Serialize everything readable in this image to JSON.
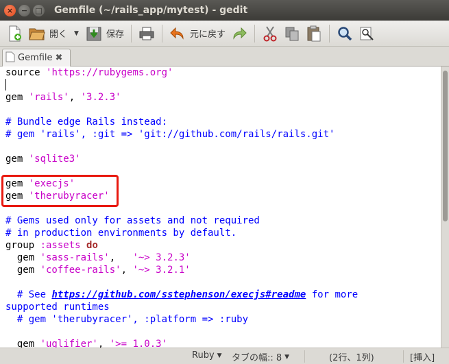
{
  "window": {
    "title": "Gemfile (~/rails_app/mytest) - gedit",
    "close_glyph": "×",
    "minimize_glyph": "−",
    "maximize_glyph": "□"
  },
  "toolbar": {
    "open_label": "開く",
    "save_label": "保存",
    "undo_label": "元に戻す",
    "dropdown_glyph": "▼"
  },
  "tab": {
    "label": "Gemfile",
    "close_glyph": "✖"
  },
  "editor": {
    "lines": [
      [
        {
          "t": "source ",
          "c": ""
        },
        {
          "t": "'https://rubygems.org'",
          "c": "str"
        }
      ],
      [],
      [
        {
          "t": "gem ",
          "c": ""
        },
        {
          "t": "'rails'",
          "c": "str"
        },
        {
          "t": ", ",
          "c": ""
        },
        {
          "t": "'3.2.3'",
          "c": "str"
        }
      ],
      [],
      [
        {
          "t": "# Bundle edge Rails instead:",
          "c": "cmt"
        }
      ],
      [
        {
          "t": "# gem 'rails', :git => 'git://github.com/rails/rails.git'",
          "c": "cmt"
        }
      ],
      [],
      [
        {
          "t": "gem ",
          "c": ""
        },
        {
          "t": "'sqlite3'",
          "c": "str"
        }
      ],
      [],
      [
        {
          "t": "gem ",
          "c": ""
        },
        {
          "t": "'execjs'",
          "c": "str"
        }
      ],
      [
        {
          "t": "gem ",
          "c": ""
        },
        {
          "t": "'therubyracer'",
          "c": "str"
        }
      ],
      [],
      [
        {
          "t": "# Gems used only for assets and not required",
          "c": "cmt"
        }
      ],
      [
        {
          "t": "# in production environments by default.",
          "c": "cmt"
        }
      ],
      [
        {
          "t": "group ",
          "c": ""
        },
        {
          "t": ":assets",
          "c": "sym"
        },
        {
          "t": " ",
          "c": ""
        },
        {
          "t": "do",
          "c": "kw"
        }
      ],
      [
        {
          "t": "  gem ",
          "c": ""
        },
        {
          "t": "'sass-rails'",
          "c": "str"
        },
        {
          "t": ",   ",
          "c": ""
        },
        {
          "t": "'~> 3.2.3'",
          "c": "str"
        }
      ],
      [
        {
          "t": "  gem ",
          "c": ""
        },
        {
          "t": "'coffee-rails'",
          "c": "str"
        },
        {
          "t": ", ",
          "c": ""
        },
        {
          "t": "'~> 3.2.1'",
          "c": "str"
        }
      ],
      [],
      [
        {
          "t": "  # See ",
          "c": "cmt"
        },
        {
          "t": "https://github.com/sstephenson/execjs#readme",
          "c": "url"
        },
        {
          "t": " for more",
          "c": "cmt"
        }
      ],
      [
        {
          "t": "supported runtimes",
          "c": "cmt"
        }
      ],
      [
        {
          "t": "  # gem 'therubyracer', :platform => :ruby",
          "c": "cmt"
        }
      ],
      [],
      [
        {
          "t": "  gem ",
          "c": ""
        },
        {
          "t": "'uglifier'",
          "c": "str"
        },
        {
          "t": ", ",
          "c": ""
        },
        {
          "t": "'>= 1.0.3'",
          "c": "str"
        }
      ]
    ]
  },
  "statusbar": {
    "language": "Ruby",
    "tab_width": "タブの幅:: 8",
    "position": "(2行、1列)",
    "insert_mode": "[挿入]",
    "dropdown_glyph": "▼"
  }
}
